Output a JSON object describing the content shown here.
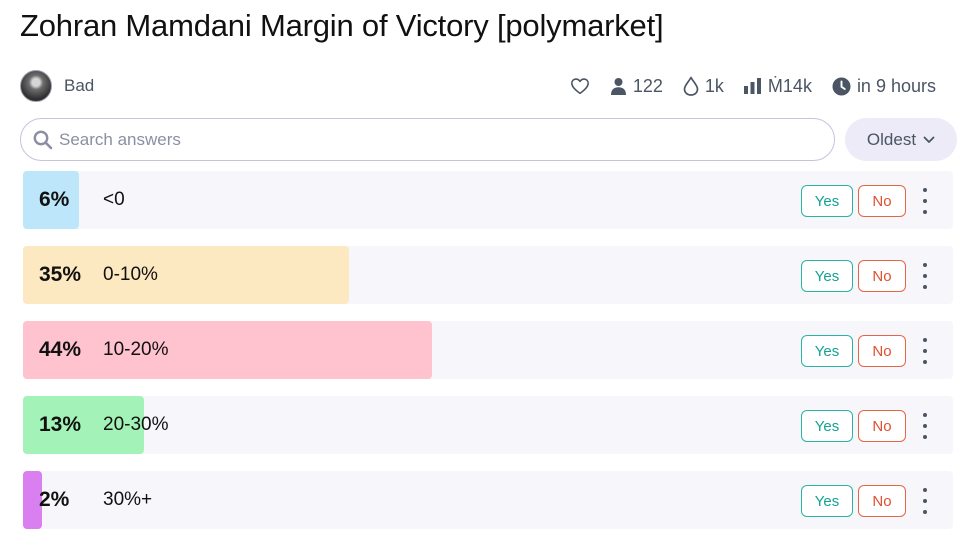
{
  "title": "Zohran Mamdani Margin of Victory [polymarket]",
  "author": {
    "name": "Bad",
    "avatar_icon": "user-avatar"
  },
  "stats": {
    "follow_icon": "heart-icon",
    "traders": "122",
    "traders_icon": "user-icon",
    "liquidity": "1k",
    "liquidity_icon": "droplet-icon",
    "volume": "Ṁ14k",
    "volume_icon": "bar-chart-icon",
    "close_time": "in 9 hours",
    "close_time_icon": "clock-icon"
  },
  "search": {
    "placeholder": "Search answers",
    "value": "",
    "icon": "search-icon"
  },
  "sort": {
    "label": "Oldest",
    "icon": "chevron-down-icon"
  },
  "answers": [
    {
      "percent": "6%",
      "probability": 0.06,
      "label": "<0",
      "color": "#bde6fb",
      "yes_label": "Yes",
      "no_label": "No"
    },
    {
      "percent": "35%",
      "probability": 0.35,
      "label": "0-10%",
      "color": "#fde9c1",
      "yes_label": "Yes",
      "no_label": "No"
    },
    {
      "percent": "44%",
      "probability": 0.44,
      "label": "10-20%",
      "color": "#ffc2cf",
      "yes_label": "Yes",
      "no_label": "No"
    },
    {
      "percent": "13%",
      "probability": 0.13,
      "label": "20-30%",
      "color": "#a3f2b8",
      "yes_label": "Yes",
      "no_label": "No"
    },
    {
      "percent": "2%",
      "probability": 0.02,
      "label": "30%+",
      "color": "#d97ff0",
      "yes_label": "Yes",
      "no_label": "No"
    }
  ]
}
